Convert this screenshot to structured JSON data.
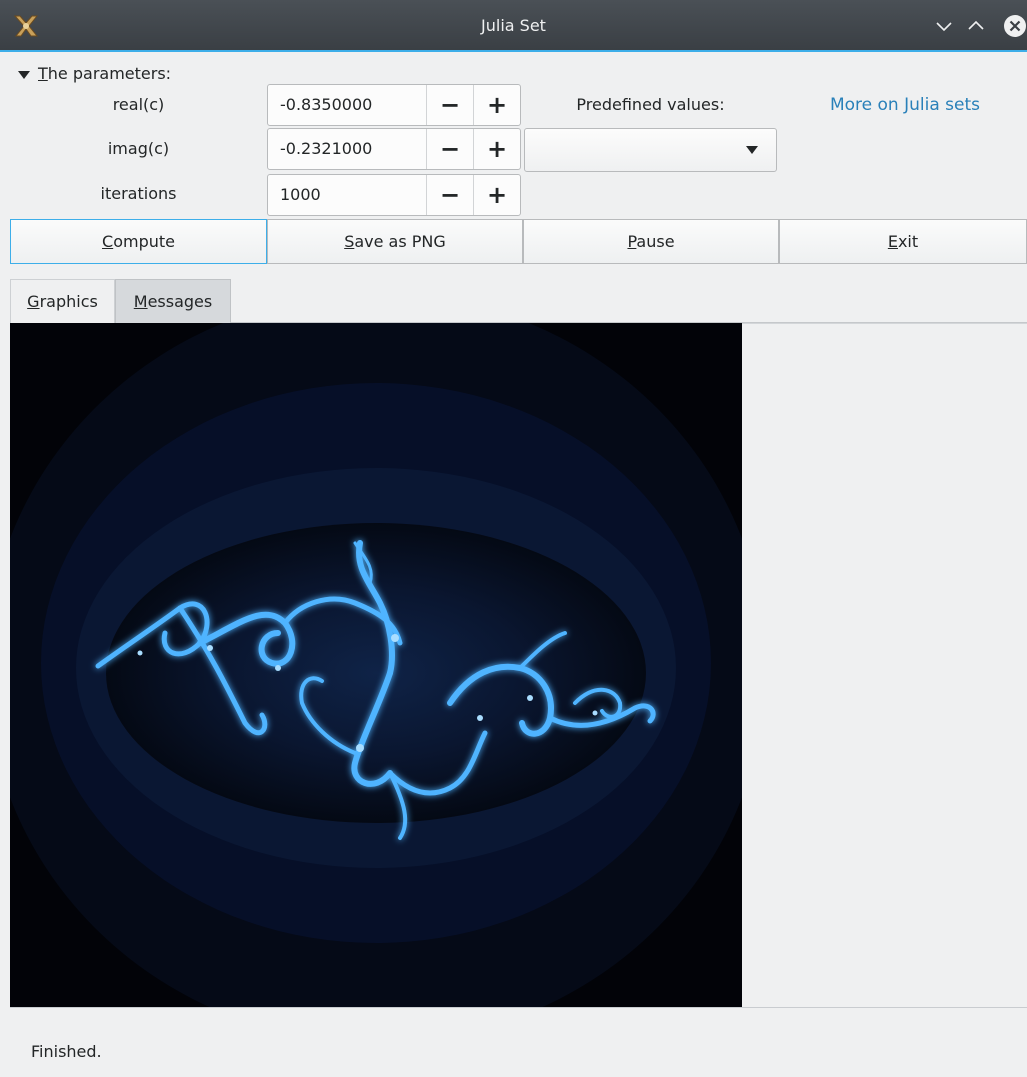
{
  "window": {
    "title": "Julia Set",
    "icon": "julia-app-icon",
    "controls": [
      "minimize-icon",
      "maximize-icon",
      "close-icon"
    ]
  },
  "params": {
    "toggle_label": "The parameters:",
    "toggle_mnemonic": "T",
    "toggle_rest": "he parameters:",
    "real": {
      "label": "real(c)",
      "value": "-0.8350000"
    },
    "imag": {
      "label": "imag(c)",
      "value": "-0.2321000"
    },
    "iterations": {
      "label": "iterations",
      "value": "1000"
    },
    "minus_glyph": "−",
    "plus_glyph": "+",
    "predefined_label": "Predefined values:",
    "predefined_selected": "",
    "link_text": "More on Julia sets"
  },
  "buttons": {
    "compute": {
      "mn": "C",
      "rest": "ompute"
    },
    "save": {
      "mn": "S",
      "rest": "ave as PNG"
    },
    "pause": {
      "mn": "P",
      "rest": "ause"
    },
    "exit": {
      "mn": "E",
      "rest": "xit"
    }
  },
  "tabs": {
    "graphics": {
      "mn": "G",
      "rest": "raphics"
    },
    "messages": {
      "mn": "M",
      "rest": "essages"
    }
  },
  "status": "Finished.",
  "colors": {
    "accent": "#3daee9",
    "link": "#2980b9",
    "fractal": "#4fb4ff",
    "canvas_bg": "#020308"
  }
}
